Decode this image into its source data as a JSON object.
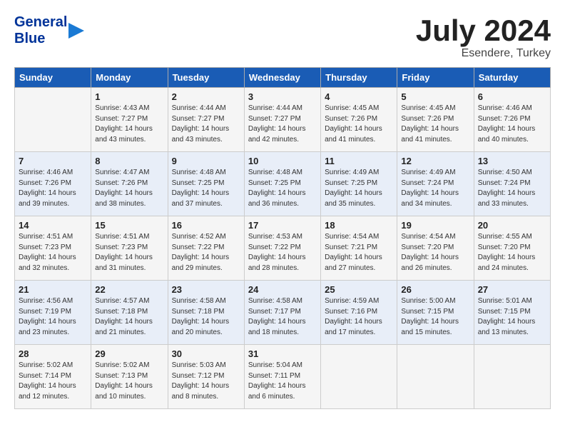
{
  "header": {
    "logo_line1": "General",
    "logo_line2": "Blue",
    "month": "July 2024",
    "location": "Esendere, Turkey"
  },
  "weekdays": [
    "Sunday",
    "Monday",
    "Tuesday",
    "Wednesday",
    "Thursday",
    "Friday",
    "Saturday"
  ],
  "weeks": [
    [
      {
        "day": "",
        "info": ""
      },
      {
        "day": "1",
        "info": "Sunrise: 4:43 AM\nSunset: 7:27 PM\nDaylight: 14 hours\nand 43 minutes."
      },
      {
        "day": "2",
        "info": "Sunrise: 4:44 AM\nSunset: 7:27 PM\nDaylight: 14 hours\nand 43 minutes."
      },
      {
        "day": "3",
        "info": "Sunrise: 4:44 AM\nSunset: 7:27 PM\nDaylight: 14 hours\nand 42 minutes."
      },
      {
        "day": "4",
        "info": "Sunrise: 4:45 AM\nSunset: 7:26 PM\nDaylight: 14 hours\nand 41 minutes."
      },
      {
        "day": "5",
        "info": "Sunrise: 4:45 AM\nSunset: 7:26 PM\nDaylight: 14 hours\nand 41 minutes."
      },
      {
        "day": "6",
        "info": "Sunrise: 4:46 AM\nSunset: 7:26 PM\nDaylight: 14 hours\nand 40 minutes."
      }
    ],
    [
      {
        "day": "7",
        "info": "Sunrise: 4:46 AM\nSunset: 7:26 PM\nDaylight: 14 hours\nand 39 minutes."
      },
      {
        "day": "8",
        "info": "Sunrise: 4:47 AM\nSunset: 7:26 PM\nDaylight: 14 hours\nand 38 minutes."
      },
      {
        "day": "9",
        "info": "Sunrise: 4:48 AM\nSunset: 7:25 PM\nDaylight: 14 hours\nand 37 minutes."
      },
      {
        "day": "10",
        "info": "Sunrise: 4:48 AM\nSunset: 7:25 PM\nDaylight: 14 hours\nand 36 minutes."
      },
      {
        "day": "11",
        "info": "Sunrise: 4:49 AM\nSunset: 7:25 PM\nDaylight: 14 hours\nand 35 minutes."
      },
      {
        "day": "12",
        "info": "Sunrise: 4:49 AM\nSunset: 7:24 PM\nDaylight: 14 hours\nand 34 minutes."
      },
      {
        "day": "13",
        "info": "Sunrise: 4:50 AM\nSunset: 7:24 PM\nDaylight: 14 hours\nand 33 minutes."
      }
    ],
    [
      {
        "day": "14",
        "info": "Sunrise: 4:51 AM\nSunset: 7:23 PM\nDaylight: 14 hours\nand 32 minutes."
      },
      {
        "day": "15",
        "info": "Sunrise: 4:51 AM\nSunset: 7:23 PM\nDaylight: 14 hours\nand 31 minutes."
      },
      {
        "day": "16",
        "info": "Sunrise: 4:52 AM\nSunset: 7:22 PM\nDaylight: 14 hours\nand 29 minutes."
      },
      {
        "day": "17",
        "info": "Sunrise: 4:53 AM\nSunset: 7:22 PM\nDaylight: 14 hours\nand 28 minutes."
      },
      {
        "day": "18",
        "info": "Sunrise: 4:54 AM\nSunset: 7:21 PM\nDaylight: 14 hours\nand 27 minutes."
      },
      {
        "day": "19",
        "info": "Sunrise: 4:54 AM\nSunset: 7:20 PM\nDaylight: 14 hours\nand 26 minutes."
      },
      {
        "day": "20",
        "info": "Sunrise: 4:55 AM\nSunset: 7:20 PM\nDaylight: 14 hours\nand 24 minutes."
      }
    ],
    [
      {
        "day": "21",
        "info": "Sunrise: 4:56 AM\nSunset: 7:19 PM\nDaylight: 14 hours\nand 23 minutes."
      },
      {
        "day": "22",
        "info": "Sunrise: 4:57 AM\nSunset: 7:18 PM\nDaylight: 14 hours\nand 21 minutes."
      },
      {
        "day": "23",
        "info": "Sunrise: 4:58 AM\nSunset: 7:18 PM\nDaylight: 14 hours\nand 20 minutes."
      },
      {
        "day": "24",
        "info": "Sunrise: 4:58 AM\nSunset: 7:17 PM\nDaylight: 14 hours\nand 18 minutes."
      },
      {
        "day": "25",
        "info": "Sunrise: 4:59 AM\nSunset: 7:16 PM\nDaylight: 14 hours\nand 17 minutes."
      },
      {
        "day": "26",
        "info": "Sunrise: 5:00 AM\nSunset: 7:15 PM\nDaylight: 14 hours\nand 15 minutes."
      },
      {
        "day": "27",
        "info": "Sunrise: 5:01 AM\nSunset: 7:15 PM\nDaylight: 14 hours\nand 13 minutes."
      }
    ],
    [
      {
        "day": "28",
        "info": "Sunrise: 5:02 AM\nSunset: 7:14 PM\nDaylight: 14 hours\nand 12 minutes."
      },
      {
        "day": "29",
        "info": "Sunrise: 5:02 AM\nSunset: 7:13 PM\nDaylight: 14 hours\nand 10 minutes."
      },
      {
        "day": "30",
        "info": "Sunrise: 5:03 AM\nSunset: 7:12 PM\nDaylight: 14 hours\nand 8 minutes."
      },
      {
        "day": "31",
        "info": "Sunrise: 5:04 AM\nSunset: 7:11 PM\nDaylight: 14 hours\nand 6 minutes."
      },
      {
        "day": "",
        "info": ""
      },
      {
        "day": "",
        "info": ""
      },
      {
        "day": "",
        "info": ""
      }
    ]
  ]
}
